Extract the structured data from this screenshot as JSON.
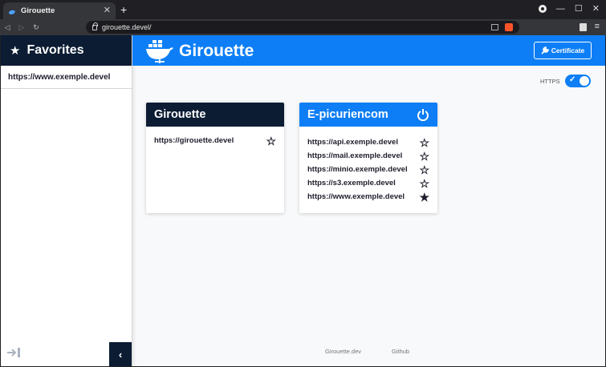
{
  "browser": {
    "tab_title": "Girouette",
    "tab_close": "✕",
    "new_tab": "+",
    "url": "girouette.devel/",
    "window_controls": [
      "—",
      "☐",
      "✕"
    ]
  },
  "sidebar": {
    "title": "Favorites",
    "favorites": [
      "https://www.exemple.devel"
    ],
    "collapse_glyph": "‹"
  },
  "header": {
    "brand": "Girouette",
    "certificate_label": "Certificate"
  },
  "https_toggle": {
    "label": "HTTPS",
    "on": true
  },
  "cards": [
    {
      "title": "Girouette",
      "style": "dark",
      "links": [
        {
          "url": "https://girouette.devel",
          "favorite": false
        }
      ]
    },
    {
      "title": "E-picuriencom",
      "style": "blue",
      "has_power_icon": true,
      "links": [
        {
          "url": "https://api.exemple.devel",
          "favorite": false
        },
        {
          "url": "https://mail.exemple.devel",
          "favorite": false
        },
        {
          "url": "https://minio.exemple.devel",
          "favorite": false
        },
        {
          "url": "https://s3.exemple.devel",
          "favorite": false
        },
        {
          "url": "https://www.exemple.devel",
          "favorite": true
        }
      ]
    }
  ],
  "footer": {
    "links": [
      "Girouette.dev",
      "Github"
    ]
  },
  "colors": {
    "primary": "#0d7ef5",
    "dark": "#0b1c33"
  },
  "star_glyphs": {
    "empty": "☆",
    "filled": "★"
  }
}
